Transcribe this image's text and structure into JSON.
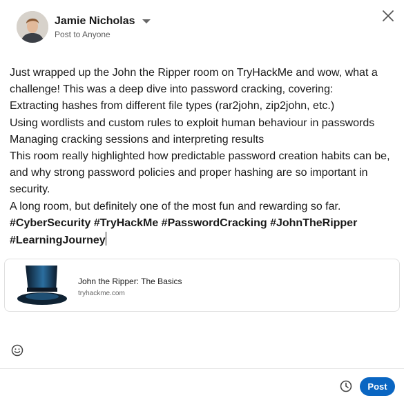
{
  "author": {
    "name": "Jamie Nicholas",
    "audience": "Post to Anyone"
  },
  "post": {
    "lines": [
      "Just wrapped up the John the Ripper room on TryHackMe and wow, what a challenge! This was a deep dive into password cracking, covering:",
      "Extracting hashes from different file types (rar2john, zip2john, etc.)",
      "Using wordlists and custom rules to exploit human behaviour in passwords",
      "Managing cracking sessions and interpreting results",
      "This room really highlighted how predictable password creation habits can be, and why strong password policies and proper hashing are so important in security.",
      "A long room, but definitely one of the most fun and rewarding so far."
    ],
    "hashtags": "#CyberSecurity #TryHackMe #PasswordCracking #JohnTheRipper #LearningJourney"
  },
  "link_preview": {
    "title": "John the Ripper: The Basics",
    "domain": "tryhackme.com"
  },
  "footer": {
    "post_label": "Post"
  },
  "icons": {
    "close": "close-icon",
    "emoji": "smiley-icon",
    "schedule": "clock-icon",
    "dropdown": "caret-down-icon"
  },
  "colors": {
    "primary": "#0a66c2",
    "text": "#191919",
    "muted": "#5e5e5e"
  }
}
